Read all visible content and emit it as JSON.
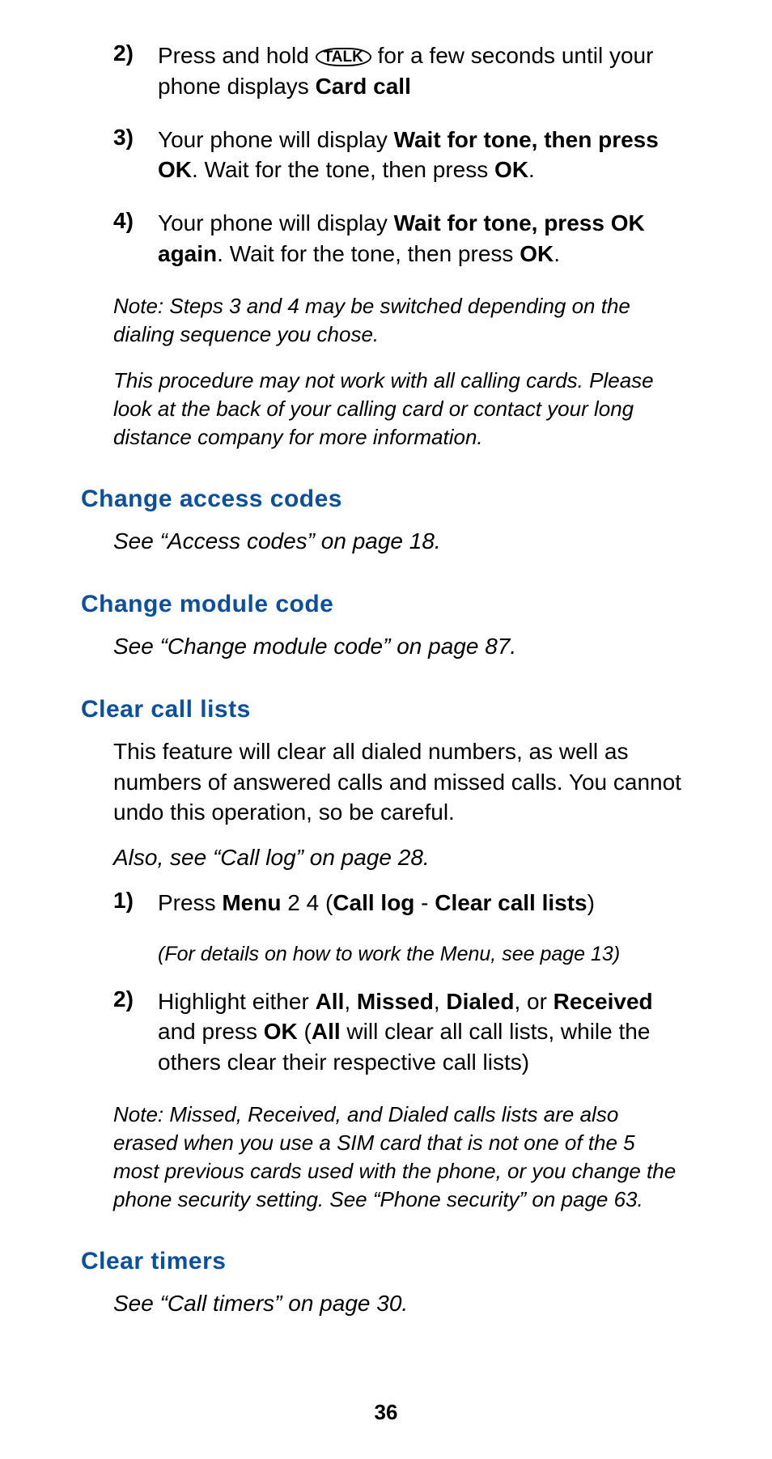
{
  "steps_top": [
    {
      "num": "2)",
      "pre": "Press and hold ",
      "talk": "TALK",
      "mid": " for a few seconds until your phone displays ",
      "bold1": "Card call"
    },
    {
      "num": "3)",
      "pre": "Your phone will display ",
      "bold1": "Wait for tone, then press OK",
      "post": ". Wait for the tone, then press ",
      "bold2": "OK",
      "tail": "."
    },
    {
      "num": "4)",
      "pre": "Your phone will display ",
      "bold1": "Wait for tone, press OK again",
      "post": ". Wait for the tone, then press ",
      "bold2": "OK",
      "tail": "."
    }
  ],
  "note1": "Note: Steps 3 and 4 may be switched depending on the dialing sequence you chose.",
  "note2": "This procedure may not work with all calling cards. Please look at the back of your calling card or contact your long distance company for more information.",
  "sec1": {
    "heading": "Change access codes",
    "body": "See “Access codes” on page 18."
  },
  "sec2": {
    "heading": "Change module code",
    "body": "See “Change module code” on page 87."
  },
  "sec3": {
    "heading": "Clear call lists",
    "intro": "This feature will clear all dialed numbers, as well as numbers of answered calls and missed calls. You cannot undo this operation, so be careful.",
    "also": "Also, see “Call log” on page 28.",
    "step1": {
      "num": "1)",
      "pre": "Press ",
      "b1": "Menu",
      "mid1": " 2 4 (",
      "b2": "Call log",
      "mid2": " - ",
      "b3": "Clear call lists",
      "tail": ")"
    },
    "step1_sub": "(For details on how to work the Menu, see page 13)",
    "step2": {
      "num": "2)",
      "pre": "Highlight either ",
      "b1": "All",
      "c1": ", ",
      "b2": "Missed",
      "c2": ", ",
      "b3": "Dialed",
      "c3": ", or ",
      "b4": "Received",
      "mid": " and press ",
      "b5": "OK",
      "mid2": " (",
      "b6": "All",
      "tail": " will clear all call lists, while the others clear their respective call lists)"
    },
    "note": "Note: Missed, Received, and Dialed calls lists are also erased when you use a SIM card that is not one of the 5 most previous cards used with the phone, or you change the phone security setting. See “Phone security” on page 63."
  },
  "sec4": {
    "heading": "Clear timers",
    "body": "See “Call timers” on page 30."
  },
  "page_number": "36"
}
